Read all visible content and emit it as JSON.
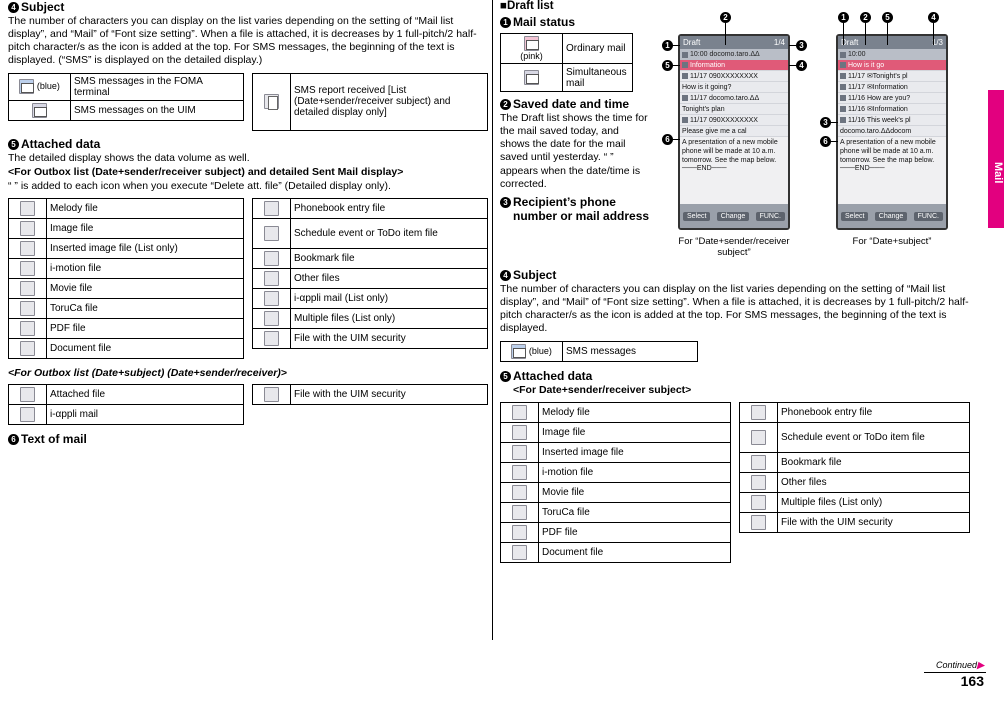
{
  "page": {
    "number": "163",
    "continued": "Continued",
    "tab_label": "Mail"
  },
  "left": {
    "sec4": {
      "num": "4",
      "title": "Subject",
      "body": "The number of characters you can display on the list varies depending on the setting of “Mail list display”, and “Mail” of “Font size setting”. When a file is attached, it is decreases by 1 full-pitch/2 half-pitch character/s as the icon is added at the top. For SMS messages, the beginning of the text is displayed. (“SMS” is displayed on the detailed display.)"
    },
    "subject_table": [
      {
        "icon": "envelope-blue-icon",
        "icon_label": "(blue)",
        "text": "SMS messages in the FOMA terminal"
      },
      {
        "icon": "envelope-icon",
        "icon_label": "",
        "text": "SMS messages on the UIM"
      }
    ],
    "subject_table_right": [
      {
        "icon": "report-icon",
        "icon_label": "",
        "text": "SMS report received [List (Date+sender/receiver subject) and detailed display only]"
      }
    ],
    "sec5": {
      "num": "5",
      "title": "Attached data",
      "body1": "The detailed display shows the data volume as well.",
      "body2": "<For Outbox list (Date+sender/receiver subject) and detailed Sent Mail display>",
      "body3": "“ ” is added to each icon when you execute “Delete att. file” (Detailed display only)."
    },
    "attached_left": [
      {
        "icon": "melody-icon",
        "text": "Melody file"
      },
      {
        "icon": "image-icon",
        "text": "Image file"
      },
      {
        "icon": "inserted-image-icon",
        "text": "Inserted image file (List only)"
      },
      {
        "icon": "imotion-icon",
        "text": "i-motion file"
      },
      {
        "icon": "movie-icon",
        "text": "Movie file"
      },
      {
        "icon": "toruca-icon",
        "text": "ToruCa file"
      },
      {
        "icon": "pdf-icon",
        "text": "PDF file"
      },
      {
        "icon": "document-icon",
        "text": "Document file"
      }
    ],
    "attached_right": [
      {
        "icon": "phonebook-icon",
        "text": "Phonebook entry file"
      },
      {
        "icon": "schedule-icon",
        "text": "Schedule event or ToDo item file"
      },
      {
        "icon": "bookmark-icon",
        "text": "Bookmark file"
      },
      {
        "icon": "other-icon",
        "text": "Other files"
      },
      {
        "icon": "iappli-icon",
        "text": "i-αppli mail (List only)"
      },
      {
        "icon": "multiple-files-icon",
        "text": "Multiple files (List only)"
      },
      {
        "icon": "uim-security-icon",
        "text": "File with the UIM security"
      }
    ],
    "outbox_heading": "<For Outbox list (Date+subject) (Date+sender/receiver)>",
    "outbox_left": [
      {
        "icon": "attached-file-icon",
        "text": "Attached file"
      },
      {
        "icon": "iappli-mail-icon",
        "text": "i-αppli mail"
      }
    ],
    "outbox_right": [
      {
        "icon": "uim-security-icon",
        "text": "File with the UIM security"
      }
    ],
    "sec6": {
      "num": "6",
      "title": "Text of mail"
    }
  },
  "right": {
    "draft_heading": "■Draft list",
    "sec1": {
      "num": "1",
      "title": "Mail status"
    },
    "mail_status": [
      {
        "icon": "envelope-pink-icon",
        "icon_label": "(pink)",
        "text": "Ordinary mail"
      },
      {
        "icon": "simultaneous-mail-icon",
        "icon_label": "",
        "text": "Simultaneous mail"
      }
    ],
    "sec2": {
      "num": "2",
      "title": "Saved date and time",
      "body": "The Draft list shows the time for the mail saved today, and shows the date for the mail saved until yesterday. “ ” appears when the date/time is corrected."
    },
    "sec3": {
      "num": "3",
      "title": "Recipient’s phone number or mail address"
    },
    "sec4": {
      "num": "4",
      "title": "Subject",
      "body": "The number of characters you can display on the list varies depending on the setting of “Mail list display”, and “Mail” of “Font size setting”. When a file is attached, it is decreases by 1 full-pitch/2 half-pitch character/s as the icon is added at the top. For SMS messages, the beginning of the text is displayed."
    },
    "sms_table": [
      {
        "icon": "envelope-blue-icon",
        "icon_label": "(blue)",
        "text": "SMS messages"
      }
    ],
    "sec5": {
      "num": "5",
      "title": "Attached data",
      "subtitle": "<For Date+sender/receiver subject>"
    },
    "attached_left": [
      {
        "icon": "melody-icon",
        "text": "Melody file"
      },
      {
        "icon": "image-icon",
        "text": "Image file"
      },
      {
        "icon": "inserted-image-icon",
        "text": "Inserted image file"
      },
      {
        "icon": "imotion-icon",
        "text": "i-motion file"
      },
      {
        "icon": "movie-icon",
        "text": "Movie file"
      },
      {
        "icon": "toruca-icon",
        "text": "ToruCa file"
      },
      {
        "icon": "pdf-icon",
        "text": "PDF file"
      },
      {
        "icon": "document-icon",
        "text": "Document file"
      }
    ],
    "attached_right": [
      {
        "icon": "phonebook-icon",
        "text": "Phonebook entry file"
      },
      {
        "icon": "schedule-icon",
        "text": "Schedule event or ToDo item file"
      },
      {
        "icon": "bookmark-icon",
        "text": "Bookmark file"
      },
      {
        "icon": "other-icon",
        "text": "Other files"
      },
      {
        "icon": "multiple-files-icon",
        "text": "Multiple files (List only)"
      },
      {
        "icon": "uim-security-icon",
        "text": "File with the UIM security"
      }
    ],
    "phone_left": {
      "title": "Draft",
      "counter": "1/4",
      "time": "10:00",
      "status_line": "docomo.taro.ΔΔ",
      "selected_row": "Information",
      "rows": [
        "11/17  090XXXXXXXX",
        "How is it going?",
        "11/17  docomo.taro.ΔΔ",
        "Tonight's plan",
        "11/17  090XXXXXXXX",
        "Please give me a cal"
      ],
      "preview": "A presentation of a new mobile phone will be made at 10 a.m. tomorrow. See the map below.\n───END───",
      "softkey_left": "Select",
      "softkey_right": "FUNC.",
      "softkey_center": "Change",
      "caption": "For “Date+sender/receiver subject”"
    },
    "phone_right": {
      "title": "Draft",
      "counter": "1/3",
      "time": "10:00",
      "status_line": "docomo.taro.ΔΔdocom",
      "selected_row": "How is it go",
      "rows": [
        "11/17  ✉Tonight's pl",
        "11/17  ✉Information",
        "11/16  How are you?",
        "11/16  ✉Information",
        "11/16  This week's pl"
      ],
      "preview": "A presentation of a new mobile phone will be made at 10 a.m. tomorrow. See the map below.\n───END───",
      "softkey_left": "Select",
      "softkey_right": "FUNC.",
      "softkey_center": "Change",
      "caption": "For “Date+subject”"
    },
    "callouts": [
      "1",
      "2",
      "3",
      "4",
      "5",
      "6"
    ]
  }
}
